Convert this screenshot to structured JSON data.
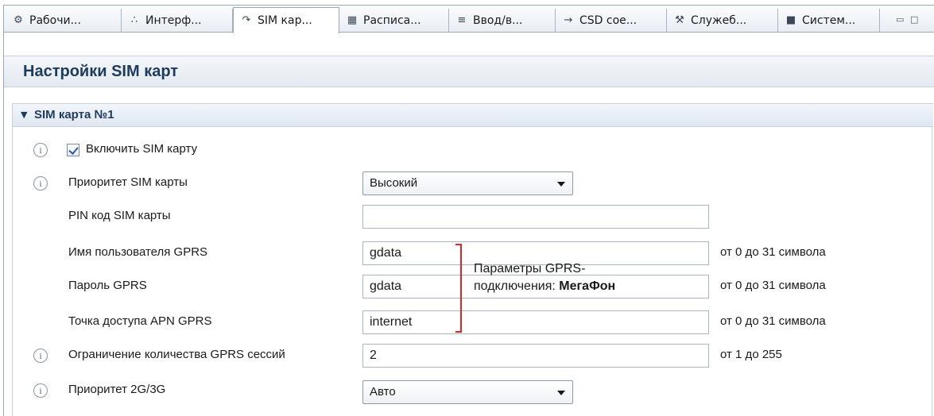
{
  "tabs": [
    {
      "label": "Рабочи...",
      "icon": "workspace-icon"
    },
    {
      "label": "Интерф...",
      "icon": "interface-icon"
    },
    {
      "label": "SIM кар...",
      "icon": "sim-icon",
      "active": true
    },
    {
      "label": "Расписа...",
      "icon": "schedule-icon"
    },
    {
      "label": "Ввод/в...",
      "icon": "io-icon"
    },
    {
      "label": "CSD сое...",
      "icon": "csd-icon"
    },
    {
      "label": "Служеб...",
      "icon": "wrench-icon"
    },
    {
      "label": "Систем...",
      "icon": "lock-icon"
    }
  ],
  "page": {
    "title": "Настройки SIM карт"
  },
  "section": {
    "title": "SIM карта №1"
  },
  "form": {
    "enable_sim": {
      "label": "Включить SIM карту",
      "checked": true
    },
    "priority": {
      "label": "Приоритет SIM карты",
      "value": "Высокий"
    },
    "pin": {
      "label": "PIN код SIM карты",
      "value": ""
    },
    "gprs_user": {
      "label": "Имя пользователя GPRS",
      "value": "gdata",
      "hint": "от 0 до 31 символа"
    },
    "gprs_pass": {
      "label": "Пароль GPRS",
      "value": "gdata",
      "hint": "от 0 до 31 символа"
    },
    "apn": {
      "label": "Точка доступа APN GPRS",
      "value": "internet",
      "hint": "от 0 до 31 символа"
    },
    "gprs_limit": {
      "label": "Ограничение количества GPRS сессий",
      "value": "2",
      "hint": "от 1 до 255"
    },
    "net_priority": {
      "label": "Приоритет 2G/3G",
      "value": "Авто"
    }
  },
  "annotation": {
    "line1": "Параметры GPRS-",
    "line2_prefix": "подключения: ",
    "operator": "МегаФон",
    "color": "#d9262a"
  }
}
